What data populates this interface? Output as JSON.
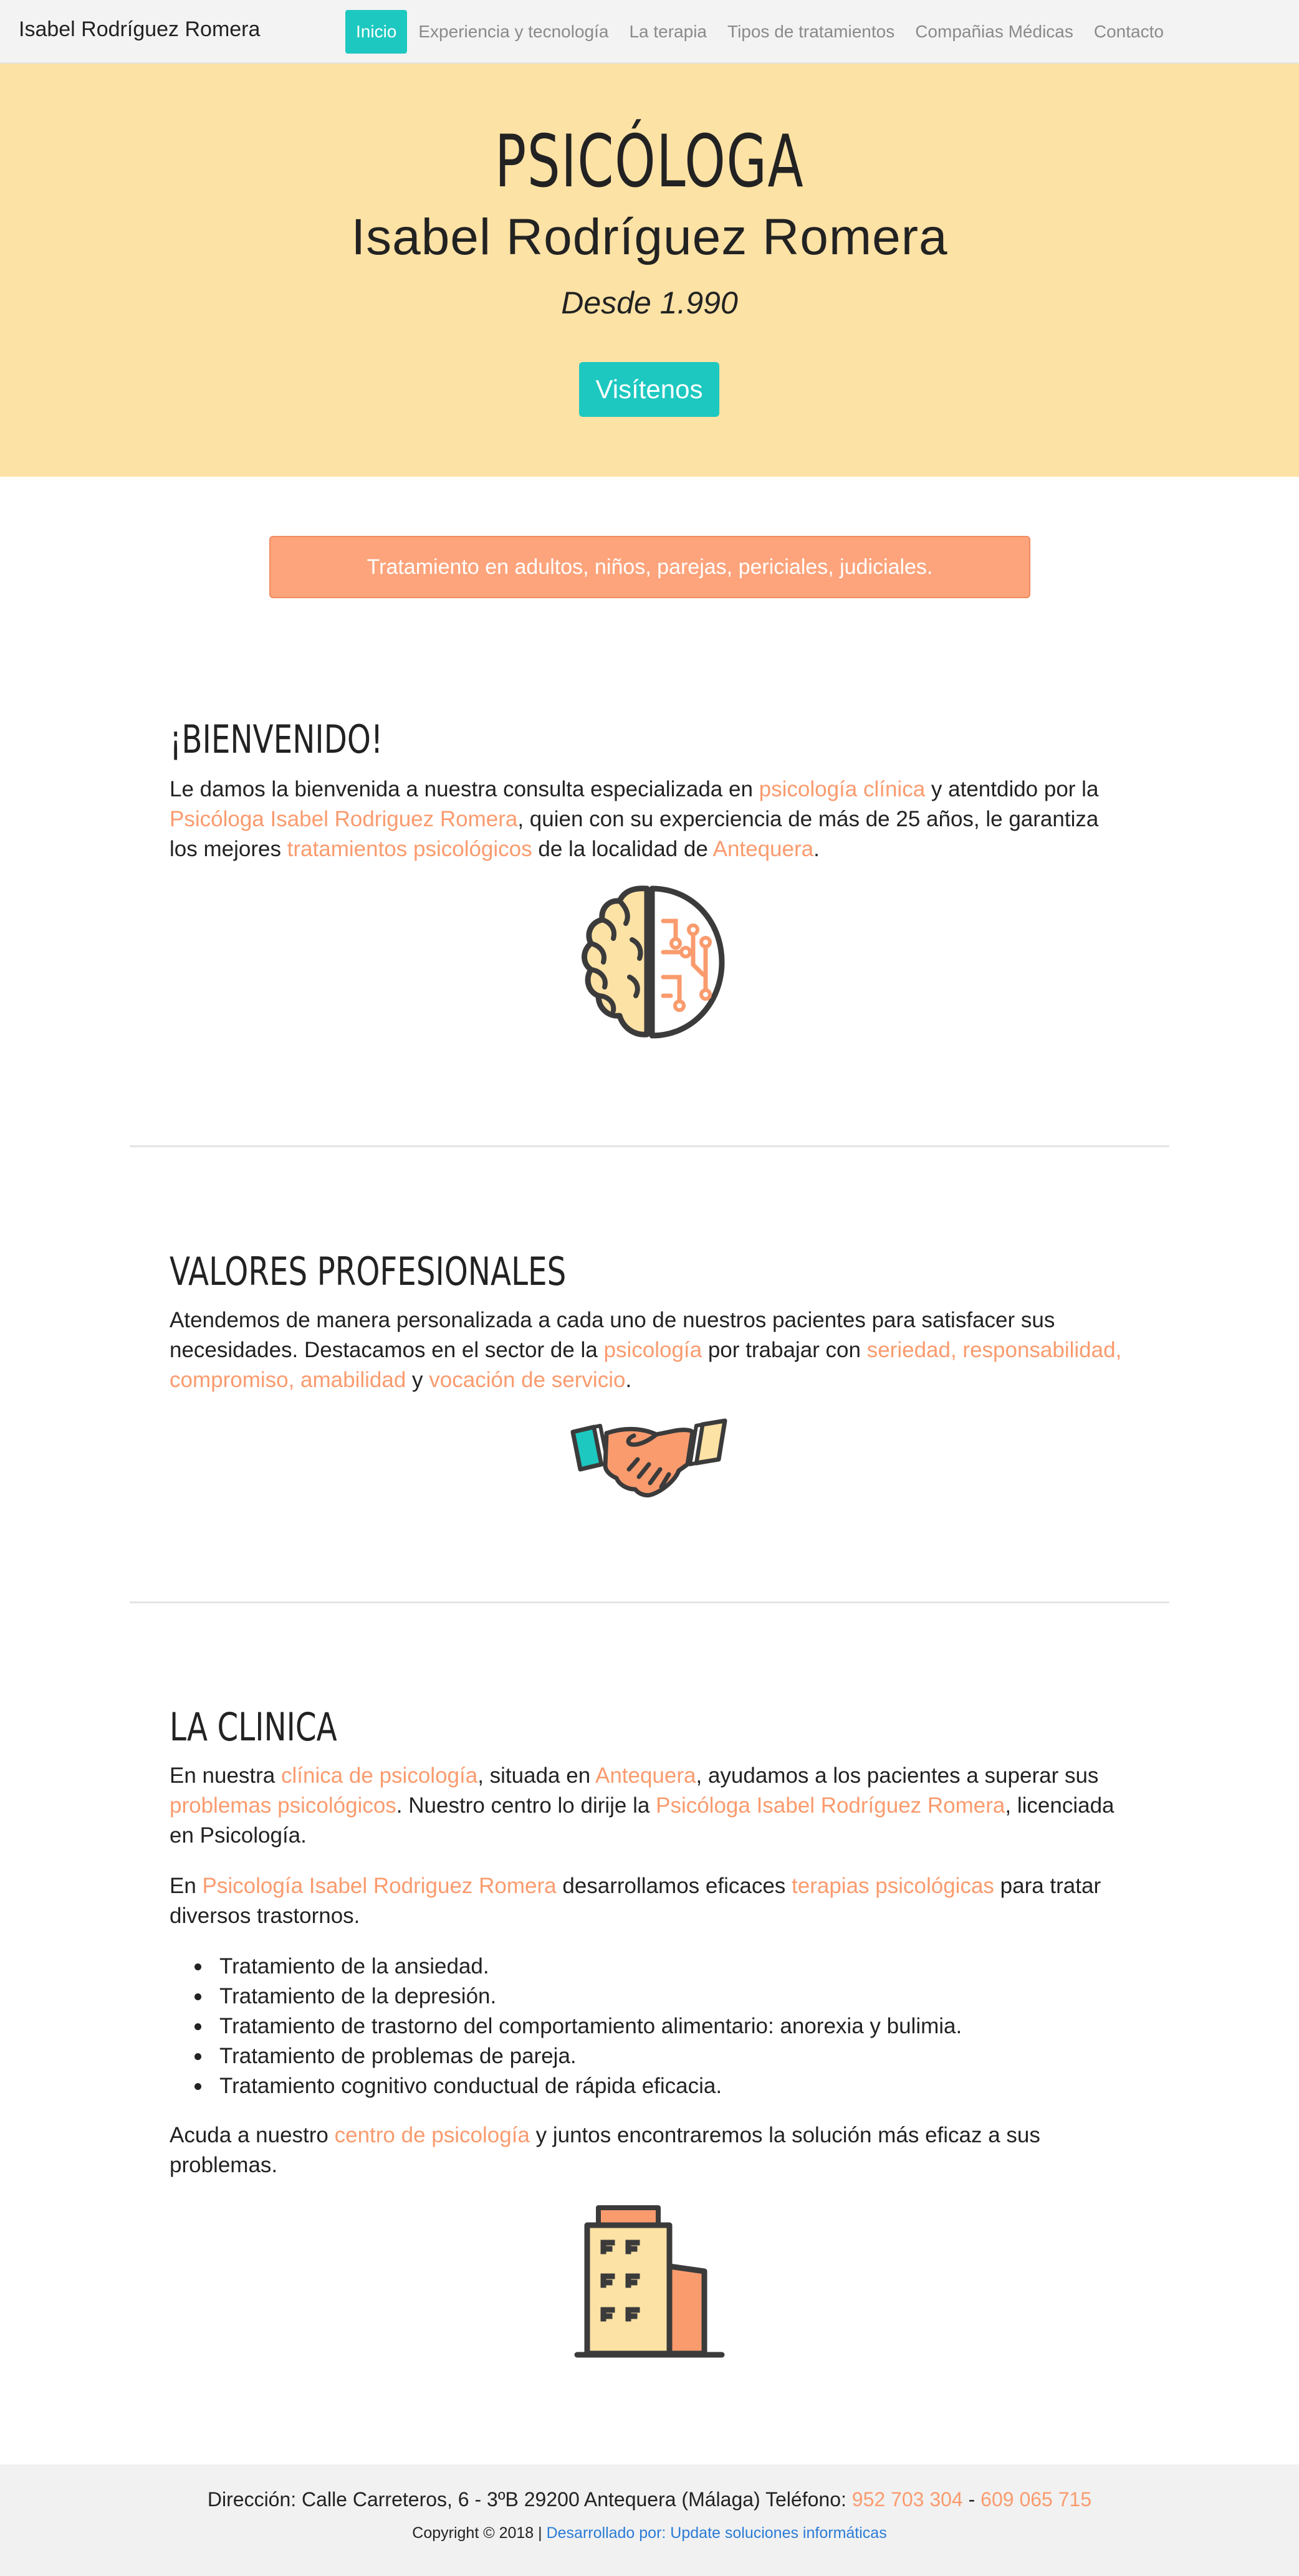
{
  "nav": {
    "brand": "Isabel Rodríguez Romera",
    "items": [
      "Inicio",
      "Experiencia y tecnología",
      "La terapia",
      "Tipos de tratamientos",
      "Compañias Médicas",
      "Contacto"
    ]
  },
  "hero": {
    "title": "PSICÓLOGA",
    "name": "Isabel Rodríguez Romera",
    "since": "Desde 1.990",
    "button": "Visítenos"
  },
  "alert": "Tratamiento en adultos, niños, parejas, periciales, judiciales.",
  "welcome": {
    "title": "¡BIENVENIDO!",
    "p1": "Le damos la bienvenida a nuestra consulta especializada en ",
    "l1": "psicología clínica",
    "p2": " y atentdido por la ",
    "l2": "Psicóloga Isabel Rodriguez Romera",
    "p3": ", quien con su experciencia de más de 25 años, le garantiza los mejores ",
    "l3": "tratamientos psicológicos",
    "p4": " de la localidad de ",
    "l4": "Antequera",
    "p5": ".",
    "icon": "brain-circuit-icon"
  },
  "values": {
    "title": "VALORES PROFESIONALES",
    "p1": "Atendemos de manera personalizada a cada uno de nuestros pacientes para satisfacer sus necesidades. Destacamos en el sector de la ",
    "l1": "psicología",
    "p2": " por trabajar con ",
    "l2": "seriedad, responsabilidad, compromiso, amabilidad",
    "p3": " y ",
    "l3": "vocación de servicio",
    "p4": ".",
    "icon": "handshake-icon"
  },
  "clinic": {
    "title": "LA CLINICA",
    "a1": "En nuestra ",
    "al1": "clínica de psicología",
    "a2": ", situada en ",
    "al2": "Antequera",
    "a3": ", ayudamos a los pacientes a superar sus ",
    "al3": "problemas psicológicos",
    "a4": ". Nuestro centro lo dirije la ",
    "al4": "Psicóloga Isabel Rodríguez Romera",
    "a5": ", licenciada en Psicología.",
    "b1": "En ",
    "bl1": "Psicología Isabel Rodriguez Romera",
    "b2": " desarrollamos eficaces ",
    "bl2": "terapias psicológicas",
    "b3": " para tratar diversos trastornos.",
    "list": [
      "Tratamiento de la ansiedad.",
      "Tratamiento de la depresión.",
      "Tratamiento de trastorno del comportamiento alimentario: anorexia y bulimia.",
      "Tratamiento de problemas de pareja.",
      "Tratamiento cognitivo conductual de rápida eficacia."
    ],
    "c1": "Acuda a nuestro ",
    "cl1": "centro de psicología",
    "c2": " y juntos encontraremos la solución más eficaz a sus problemas.",
    "icon": "building-icon"
  },
  "footer": {
    "address": "Dirección: Calle Carreteros, 6 - 3ºB 29200 Antequera (Málaga) Teléfono: ",
    "phone1": "952 703 304",
    "sep": " - ",
    "phone2": "609 065 715",
    "copyright": "Copyright © 2018 | ",
    "developer": "Desarrollado por: Update soluciones informáticas"
  },
  "colors": {
    "accent_teal": "#1dc8c0",
    "hero_bg": "#fde2a5",
    "link_orange": "#fa9b6e",
    "alert_bg": "#fda47c"
  }
}
